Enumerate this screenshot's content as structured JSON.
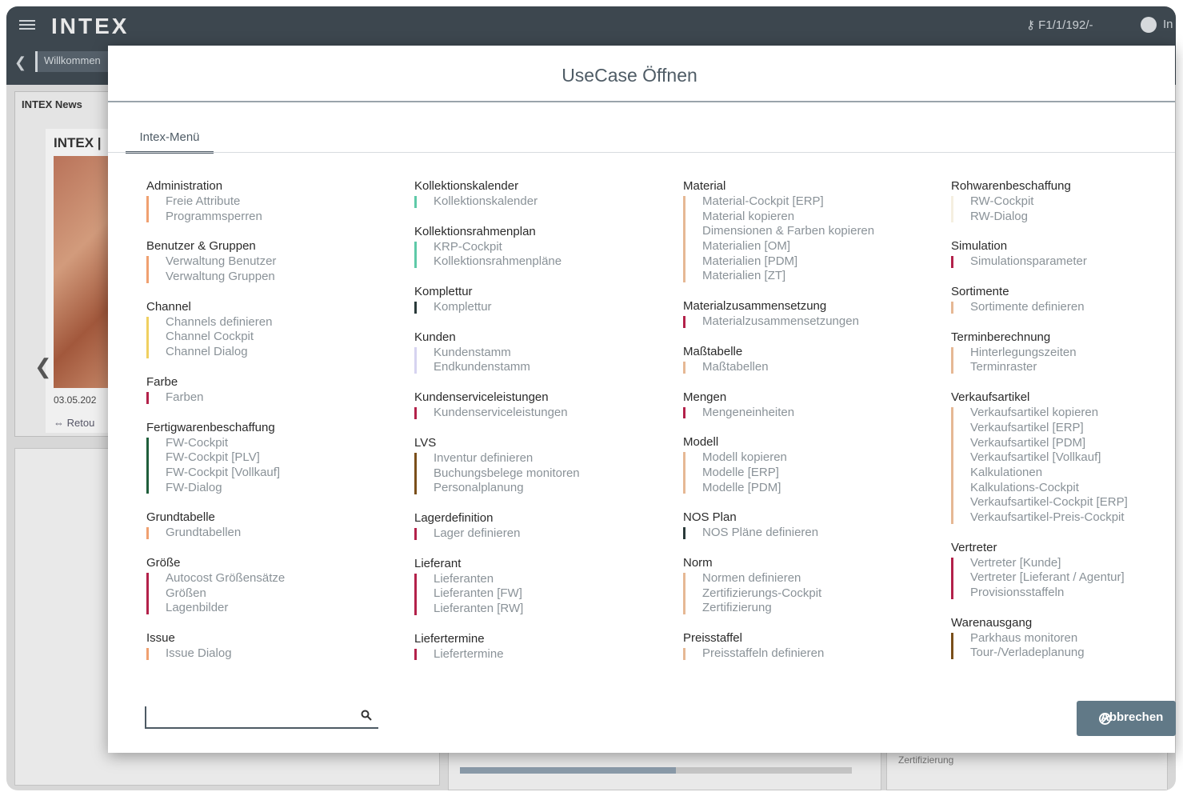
{
  "app": {
    "logo": "INTEX",
    "key_info": "⚷ F1/1/192/-",
    "user_text": "In",
    "welcome_tab": "Willkommen",
    "news_title": "INTEX News",
    "news_card_title": "INTEX |",
    "news_date": "03.05.202",
    "news_link": "⇔ Retou",
    "lower_text": "Zertifizierung",
    "progress_fraction": 0.55
  },
  "dialog": {
    "title": "UseCase Öffnen",
    "tab_label": "Intex-Menü",
    "search_placeholder": "",
    "cancel_label": "Abbrechen"
  },
  "colors": {
    "orange": "#f0a070",
    "yellow": "#f0d060",
    "crimson": "#b3214a",
    "darkgreen": "#1f5e3b",
    "teal": "#5ec9a8",
    "black": "#2a3a3a",
    "lavender": "#d6d3f0",
    "brown": "#7a4f1a",
    "tan": "#e6b894"
  },
  "columns": [
    {
      "groups": [
        {
          "title": "Administration",
          "color": "#f0a070",
          "items": [
            "Freie Attribute",
            "Programmsperren"
          ]
        },
        {
          "title": "Benutzer & Gruppen",
          "color": "#f0a070",
          "items": [
            "Verwaltung Benutzer",
            "Verwaltung Gruppen"
          ]
        },
        {
          "title": "Channel",
          "color": "#f0d060",
          "items": [
            "Channels definieren",
            "Channel Cockpit",
            "Channel Dialog"
          ]
        },
        {
          "title": "Farbe",
          "color": "#b3214a",
          "items": [
            "Farben"
          ]
        },
        {
          "title": "Fertigwarenbeschaffung",
          "color": "#1f5e3b",
          "items": [
            "FW-Cockpit",
            "FW-Cockpit [PLV]",
            "FW-Cockpit [Vollkauf]",
            "FW-Dialog"
          ]
        },
        {
          "title": "Grundtabelle",
          "color": "#f0a070",
          "items": [
            "Grundtabellen"
          ]
        },
        {
          "title": "Größe",
          "color": "#b3214a",
          "items": [
            "Autocost Größensätze",
            "Größen",
            "Lagenbilder"
          ]
        },
        {
          "title": "Issue",
          "color": "#f0a070",
          "items": [
            "Issue Dialog"
          ]
        }
      ]
    },
    {
      "groups": [
        {
          "title": "Kollektionskalender",
          "color": "#5ec9a8",
          "items": [
            "Kollektionskalender"
          ]
        },
        {
          "title": "Kollektionsrahmenplan",
          "color": "#5ec9a8",
          "items": [
            "KRP-Cockpit",
            "Kollektionsrahmenpläne"
          ]
        },
        {
          "title": "Komplettur",
          "color": "#2a3a3a",
          "items": [
            "Komplettur"
          ]
        },
        {
          "title": "Kunden",
          "color": "#d6d3f0",
          "items": [
            "Kundenstamm",
            "Endkundenstamm"
          ]
        },
        {
          "title": "Kundenserviceleistungen",
          "color": "#b3214a",
          "items": [
            "Kundenserviceleistungen"
          ]
        },
        {
          "title": "LVS",
          "color": "#7a4f1a",
          "items": [
            "Inventur definieren",
            "Buchungsbelege monitoren",
            "Personalplanung"
          ]
        },
        {
          "title": "Lagerdefinition",
          "color": "#b3214a",
          "items": [
            "Lager definieren"
          ]
        },
        {
          "title": "Lieferant",
          "color": "#b3214a",
          "items": [
            "Lieferanten",
            "Lieferanten [FW]",
            "Lieferanten [RW]"
          ]
        },
        {
          "title": "Liefertermine",
          "color": "#b3214a",
          "items": [
            "Liefertermine"
          ]
        }
      ]
    },
    {
      "groups": [
        {
          "title": "Material",
          "color": "#e6b894",
          "items": [
            "Material-Cockpit [ERP]",
            "Material kopieren",
            "Dimensionen & Farben kopieren",
            "Materialien [OM]",
            "Materialien [PDM]",
            "Materialien [ZT]"
          ]
        },
        {
          "title": "Materialzusammensetzung",
          "color": "#b3214a",
          "items": [
            "Materialzusammensetzungen"
          ]
        },
        {
          "title": "Maßtabelle",
          "color": "#e6b894",
          "items": [
            "Maßtabellen"
          ]
        },
        {
          "title": "Mengen",
          "color": "#b3214a",
          "items": [
            "Mengeneinheiten"
          ]
        },
        {
          "title": "Modell",
          "color": "#e6b894",
          "items": [
            "Modell kopieren",
            "Modelle [ERP]",
            "Modelle [PDM]"
          ]
        },
        {
          "title": "NOS Plan",
          "color": "#2a3a3a",
          "items": [
            "NOS Pläne definieren"
          ]
        },
        {
          "title": "Norm",
          "color": "#e6b894",
          "items": [
            "Normen definieren",
            "Zertifizierungs-Cockpit",
            "Zertifizierung"
          ]
        },
        {
          "title": "Preisstaffel",
          "color": "#e6b894",
          "items": [
            "Preisstaffeln definieren"
          ]
        }
      ]
    },
    {
      "groups": [
        {
          "title": "Rohwarenbeschaffung",
          "color": "#f5efe0",
          "items": [
            "RW-Cockpit",
            "RW-Dialog"
          ]
        },
        {
          "title": "Simulation",
          "color": "#b3214a",
          "items": [
            "Simulationsparameter"
          ]
        },
        {
          "title": "Sortimente",
          "color": "#e6b894",
          "items": [
            "Sortimente definieren"
          ]
        },
        {
          "title": "Terminberechnung",
          "color": "#e6b894",
          "items": [
            "Hinterlegungszeiten",
            "Terminraster"
          ]
        },
        {
          "title": "Verkaufsartikel",
          "color": "#e6b894",
          "items": [
            "Verkaufsartikel kopieren",
            "Verkaufsartikel [ERP]",
            "Verkaufsartikel [PDM]",
            "Verkaufsartikel [Vollkauf]",
            "Kalkulationen",
            "Kalkulations-Cockpit",
            "Verkaufsartikel-Cockpit [ERP]",
            "Verkaufsartikel-Preis-Cockpit"
          ]
        },
        {
          "title": "Vertreter",
          "color": "#b3214a",
          "items": [
            "Vertreter [Kunde]",
            "Vertreter [Lieferant / Agentur]",
            "Provisionsstaffeln"
          ]
        },
        {
          "title": "Warenausgang",
          "color": "#7a4f1a",
          "items": [
            "Parkhaus monitoren",
            "Tour-/Verladeplanung"
          ]
        }
      ]
    }
  ]
}
